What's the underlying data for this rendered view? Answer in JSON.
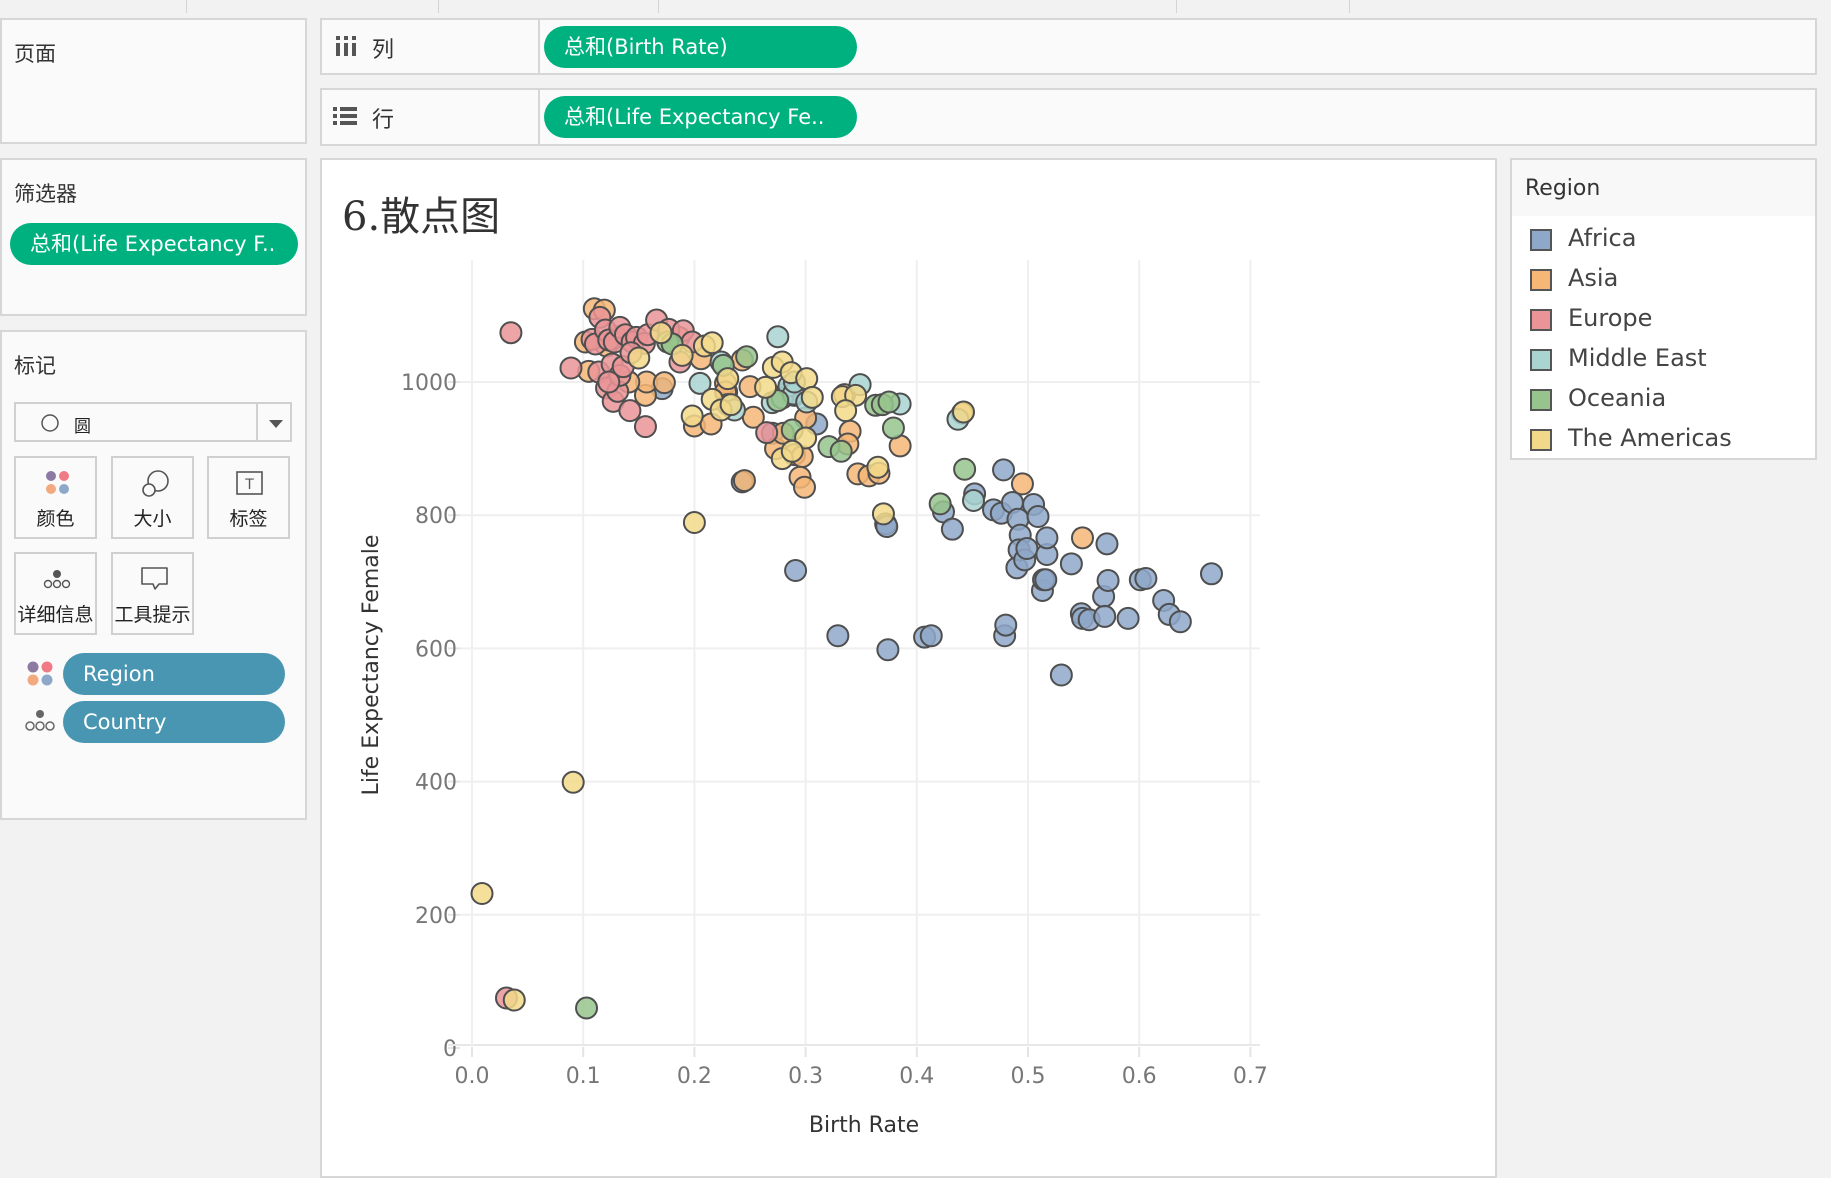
{
  "shelves": {
    "pages_label": "页面",
    "columns_label": "列",
    "rows_label": "行",
    "columns_pill": "总和(Birth Rate)",
    "rows_pill": "总和(Life Expectancy Fe.."
  },
  "filters": {
    "title": "筛选器",
    "pill": "总和(Life Expectancy F.."
  },
  "marks": {
    "title": "标记",
    "mark_type": "圆",
    "buttons": [
      {
        "label": "颜色",
        "icon": "color-icon"
      },
      {
        "label": "大小",
        "icon": "size-icon"
      },
      {
        "label": "标签",
        "icon": "label-icon"
      },
      {
        "label": "详细信息",
        "icon": "detail-icon"
      },
      {
        "label": "工具提示",
        "icon": "tooltip-icon"
      }
    ],
    "fields": [
      {
        "label": "Region",
        "icon": "color-icon"
      },
      {
        "label": "Country",
        "icon": "detail-icon"
      }
    ]
  },
  "legend": {
    "title": "Region",
    "items": [
      {
        "label": "Africa",
        "color": "#8ea8c9"
      },
      {
        "label": "Asia",
        "color": "#f5b676"
      },
      {
        "label": "Europe",
        "color": "#ea9497"
      },
      {
        "label": "Middle East",
        "color": "#a9d4d0"
      },
      {
        "label": "Oceania",
        "color": "#97c48c"
      },
      {
        "label": "The Americas",
        "color": "#f2d98a"
      }
    ]
  },
  "chart_data": {
    "type": "scatter",
    "title": "6.散点图",
    "xlabel": "Birth Rate",
    "ylabel": "Life Expectancy Female",
    "xlim": [
      -0.01,
      0.7
    ],
    "ylim": [
      0,
      1100
    ],
    "xticks": [
      "0.0",
      "0.1",
      "0.2",
      "0.3",
      "0.4",
      "0.5",
      "0.6",
      "0.7"
    ],
    "xtick_values": [
      0,
      0.1,
      0.2,
      0.3,
      0.4,
      0.5,
      0.6,
      0.7
    ],
    "yticks": [
      "0",
      "200",
      "400",
      "600",
      "800",
      "1000"
    ],
    "ytick_values": [
      0,
      200,
      400,
      600,
      800,
      1000
    ],
    "grid": true,
    "legend_position": "right",
    "series": [
      {
        "name": "Africa",
        "points": [
          [
            0.243,
            850
          ],
          [
            0.291,
            717
          ],
          [
            0.329,
            619
          ],
          [
            0.374,
            598
          ],
          [
            0.372,
            787
          ],
          [
            0.373,
            783
          ],
          [
            0.407,
            617
          ],
          [
            0.413,
            619
          ],
          [
            0.424,
            805
          ],
          [
            0.432,
            779
          ],
          [
            0.469,
            808
          ],
          [
            0.476,
            803
          ],
          [
            0.479,
            619
          ],
          [
            0.48,
            635
          ],
          [
            0.478,
            868
          ],
          [
            0.486,
            819
          ],
          [
            0.491,
            794
          ],
          [
            0.49,
            721
          ],
          [
            0.493,
            770
          ],
          [
            0.492,
            748
          ],
          [
            0.497,
            733
          ],
          [
            0.499,
            750
          ],
          [
            0.505,
            816
          ],
          [
            0.509,
            798
          ],
          [
            0.513,
            687
          ],
          [
            0.514,
            703
          ],
          [
            0.516,
            703
          ],
          [
            0.517,
            741
          ],
          [
            0.517,
            766
          ],
          [
            0.53,
            560
          ],
          [
            0.539,
            727
          ],
          [
            0.548,
            652
          ],
          [
            0.549,
            645
          ],
          [
            0.555,
            643
          ],
          [
            0.568,
            678
          ],
          [
            0.569,
            648
          ],
          [
            0.571,
            757
          ],
          [
            0.572,
            702
          ],
          [
            0.59,
            645
          ],
          [
            0.601,
            703
          ],
          [
            0.606,
            705
          ],
          [
            0.622,
            672
          ],
          [
            0.627,
            651
          ],
          [
            0.637,
            640
          ],
          [
            0.665,
            712
          ],
          [
            0.282,
            983
          ],
          [
            0.31,
            937
          ],
          [
            0.29,
            980
          ],
          [
            0.452,
            832
          ],
          [
            0.171,
            990
          ],
          [
            0.229,
            985
          ],
          [
            0.27,
            923
          ]
        ]
      },
      {
        "name": "Asia",
        "points": [
          [
            0.11,
            1110
          ],
          [
            0.119,
            1108
          ],
          [
            0.102,
            1060
          ],
          [
            0.105,
            1016
          ],
          [
            0.129,
            1068
          ],
          [
            0.126,
            1064
          ],
          [
            0.156,
            980
          ],
          [
            0.157,
            1000
          ],
          [
            0.173,
            999
          ],
          [
            0.2,
            934
          ],
          [
            0.215,
            937
          ],
          [
            0.228,
            998
          ],
          [
            0.243,
            1033
          ],
          [
            0.25,
            993
          ],
          [
            0.253,
            947
          ],
          [
            0.273,
            900
          ],
          [
            0.29,
            891
          ],
          [
            0.297,
            888
          ],
          [
            0.295,
            857
          ],
          [
            0.299,
            842
          ],
          [
            0.3,
            946
          ],
          [
            0.28,
            923
          ],
          [
            0.245,
            852
          ],
          [
            0.34,
            926
          ],
          [
            0.347,
            862
          ],
          [
            0.357,
            859
          ],
          [
            0.366,
            863
          ],
          [
            0.385,
            904
          ],
          [
            0.338,
            907
          ],
          [
            0.335,
            981
          ],
          [
            0.441,
            953
          ],
          [
            0.495,
            847
          ],
          [
            0.549,
            766
          ],
          [
            0.228,
            985
          ],
          [
            0.206,
            1035
          ],
          [
            0.121,
            1054
          ],
          [
            0.186,
            1067
          ],
          [
            0.141,
            1000
          ]
        ]
      },
      {
        "name": "Europe",
        "points": [
          [
            0.035,
            1074
          ],
          [
            0.089,
            1021
          ],
          [
            0.108,
            1064
          ],
          [
            0.111,
            1057
          ],
          [
            0.115,
            1097
          ],
          [
            0.12,
            1078
          ],
          [
            0.123,
            1063
          ],
          [
            0.128,
            1060
          ],
          [
            0.133,
            1082
          ],
          [
            0.138,
            1071
          ],
          [
            0.144,
            1060
          ],
          [
            0.148,
            1067
          ],
          [
            0.155,
            1058
          ],
          [
            0.158,
            1071
          ],
          [
            0.166,
            1093
          ],
          [
            0.177,
            1079
          ],
          [
            0.19,
            1077
          ],
          [
            0.198,
            1060
          ],
          [
            0.114,
            1015
          ],
          [
            0.121,
            991
          ],
          [
            0.126,
            1027
          ],
          [
            0.127,
            971
          ],
          [
            0.131,
            986
          ],
          [
            0.133,
            1010
          ],
          [
            0.136,
            1023
          ],
          [
            0.142,
            957
          ],
          [
            0.156,
            933
          ],
          [
            0.143,
            1044
          ],
          [
            0.123,
            1000
          ],
          [
            0.265,
            924
          ],
          [
            0.031,
            75
          ],
          [
            0.187,
            1030
          ]
        ]
      },
      {
        "name": "Middle East",
        "points": [
          [
            0.275,
            1068
          ],
          [
            0.205,
            998
          ],
          [
            0.23,
            966
          ],
          [
            0.236,
            958
          ],
          [
            0.27,
            969
          ],
          [
            0.279,
            976
          ],
          [
            0.285,
            994
          ],
          [
            0.289,
            982
          ],
          [
            0.301,
            970
          ],
          [
            0.349,
            996
          ],
          [
            0.385,
            967
          ],
          [
            0.437,
            944
          ],
          [
            0.451,
            822
          ],
          [
            0.224,
            1030
          ],
          [
            0.29,
            1000
          ]
        ]
      },
      {
        "name": "Oceania",
        "points": [
          [
            0.176,
            1060
          ],
          [
            0.226,
            1025
          ],
          [
            0.247,
            1038
          ],
          [
            0.275,
            972
          ],
          [
            0.288,
            928
          ],
          [
            0.321,
            903
          ],
          [
            0.332,
            896
          ],
          [
            0.363,
            965
          ],
          [
            0.369,
            966
          ],
          [
            0.375,
            970
          ],
          [
            0.379,
            931
          ],
          [
            0.421,
            817
          ],
          [
            0.443,
            869
          ],
          [
            0.103,
            60
          ],
          [
            0.18,
            1057
          ]
        ]
      },
      {
        "name": "The Americas",
        "points": [
          [
            0.009,
            232
          ],
          [
            0.038,
            72
          ],
          [
            0.091,
            399
          ],
          [
            0.2,
            789
          ],
          [
            0.198,
            949
          ],
          [
            0.216,
            974
          ],
          [
            0.224,
            958
          ],
          [
            0.209,
            1054
          ],
          [
            0.216,
            1059
          ],
          [
            0.189,
            1040
          ],
          [
            0.233,
            966
          ],
          [
            0.264,
            992
          ],
          [
            0.271,
            1022
          ],
          [
            0.279,
            1030
          ],
          [
            0.287,
            1014
          ],
          [
            0.301,
            1005
          ],
          [
            0.306,
            977
          ],
          [
            0.3,
            916
          ],
          [
            0.279,
            885
          ],
          [
            0.288,
            896
          ],
          [
            0.333,
            978
          ],
          [
            0.345,
            980
          ],
          [
            0.336,
            957
          ],
          [
            0.37,
            802
          ],
          [
            0.365,
            872
          ],
          [
            0.442,
            955
          ],
          [
            0.15,
            1036
          ],
          [
            0.17,
            1074
          ],
          [
            0.23,
            1005
          ]
        ]
      }
    ]
  }
}
